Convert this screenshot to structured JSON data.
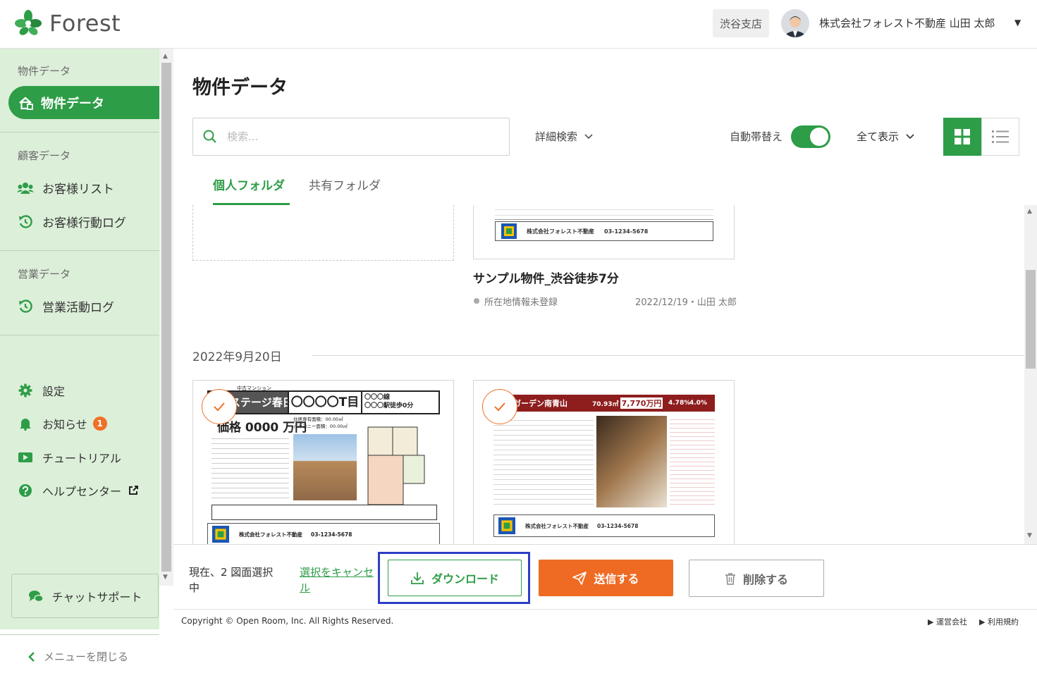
{
  "header": {
    "logo_text": "Forest",
    "branch": "渋谷支店",
    "user_name": "株式会社フォレスト不動産 山田 太郎",
    "caret": "▼"
  },
  "sidebar": {
    "sections": [
      {
        "title": "物件データ"
      },
      {
        "title": "顧客データ"
      },
      {
        "title": "営業データ"
      }
    ],
    "active_item": "物件データ",
    "customer_items": [
      "お客様リスト",
      "お客様行動ログ"
    ],
    "sales_items": [
      "営業活動ログ"
    ],
    "settings": "設定",
    "notifications": "お知らせ",
    "notification_count": "1",
    "tutorial": "チュートリアル",
    "help": "ヘルプセンター",
    "chat_support": "チャットサポート",
    "close_menu": "メニューを閉じる"
  },
  "main": {
    "title": "物件データ",
    "search_placeholder": "検索...",
    "advanced_search": "詳細検索",
    "auto_switch": "自動帯替え",
    "auto_switch_on": true,
    "show_all": "全て表示",
    "tabs": [
      {
        "label": "個人フォルダ",
        "active": true
      },
      {
        "label": "共有フォルダ",
        "active": false
      }
    ]
  },
  "cards_top": {
    "title": "サンプル物件_渋谷徒歩7分",
    "location_status": "所在地情報未登録",
    "date_author": "2022/12/19・山田 太郎",
    "flyer_company": "株式会社フォレスト不動産",
    "flyer_phone": "03-1234-5678"
  },
  "date_group": "2022年9月20日",
  "cards_group": [
    {
      "header_type": "中古マンション",
      "name": "〇〇ステージ春日",
      "address": "〇〇〇〇T目",
      "station_line": "〇〇〇線",
      "station": "〇〇〇駅徒歩0分",
      "price": "価格 0000 万円",
      "area1": "住居専有面積：00.00㎡",
      "area2": "バルコニー面積：00.00㎡",
      "selected": true,
      "company": "株式会社フォレスト不動産",
      "phone": "03-1234-5678"
    },
    {
      "name": "リヤガーデン南青山",
      "size": "70.93㎡",
      "price": "7,770万円",
      "yield1": "4.78%",
      "yield2": "4.0%",
      "selected": true,
      "company": "株式会社フォレスト不動産",
      "phone": "03-1234-5678"
    }
  ],
  "bottom_bar": {
    "selection_text": "現在、2 図面選択中",
    "cancel_link": "選択をキャンセル",
    "download": "ダウンロード",
    "send": "送信する",
    "delete": "削除する"
  },
  "footer": {
    "copyright": "Copyright © Open Room, Inc. All Rights Reserved.",
    "links": [
      "▶ 運営会社",
      "▶ 利用規約"
    ]
  },
  "colors": {
    "brand_green": "#2e9d47",
    "sidebar_bg": "#dcefd9",
    "accent_orange": "#ef6b24",
    "focus_blue": "#2c3ec6"
  }
}
